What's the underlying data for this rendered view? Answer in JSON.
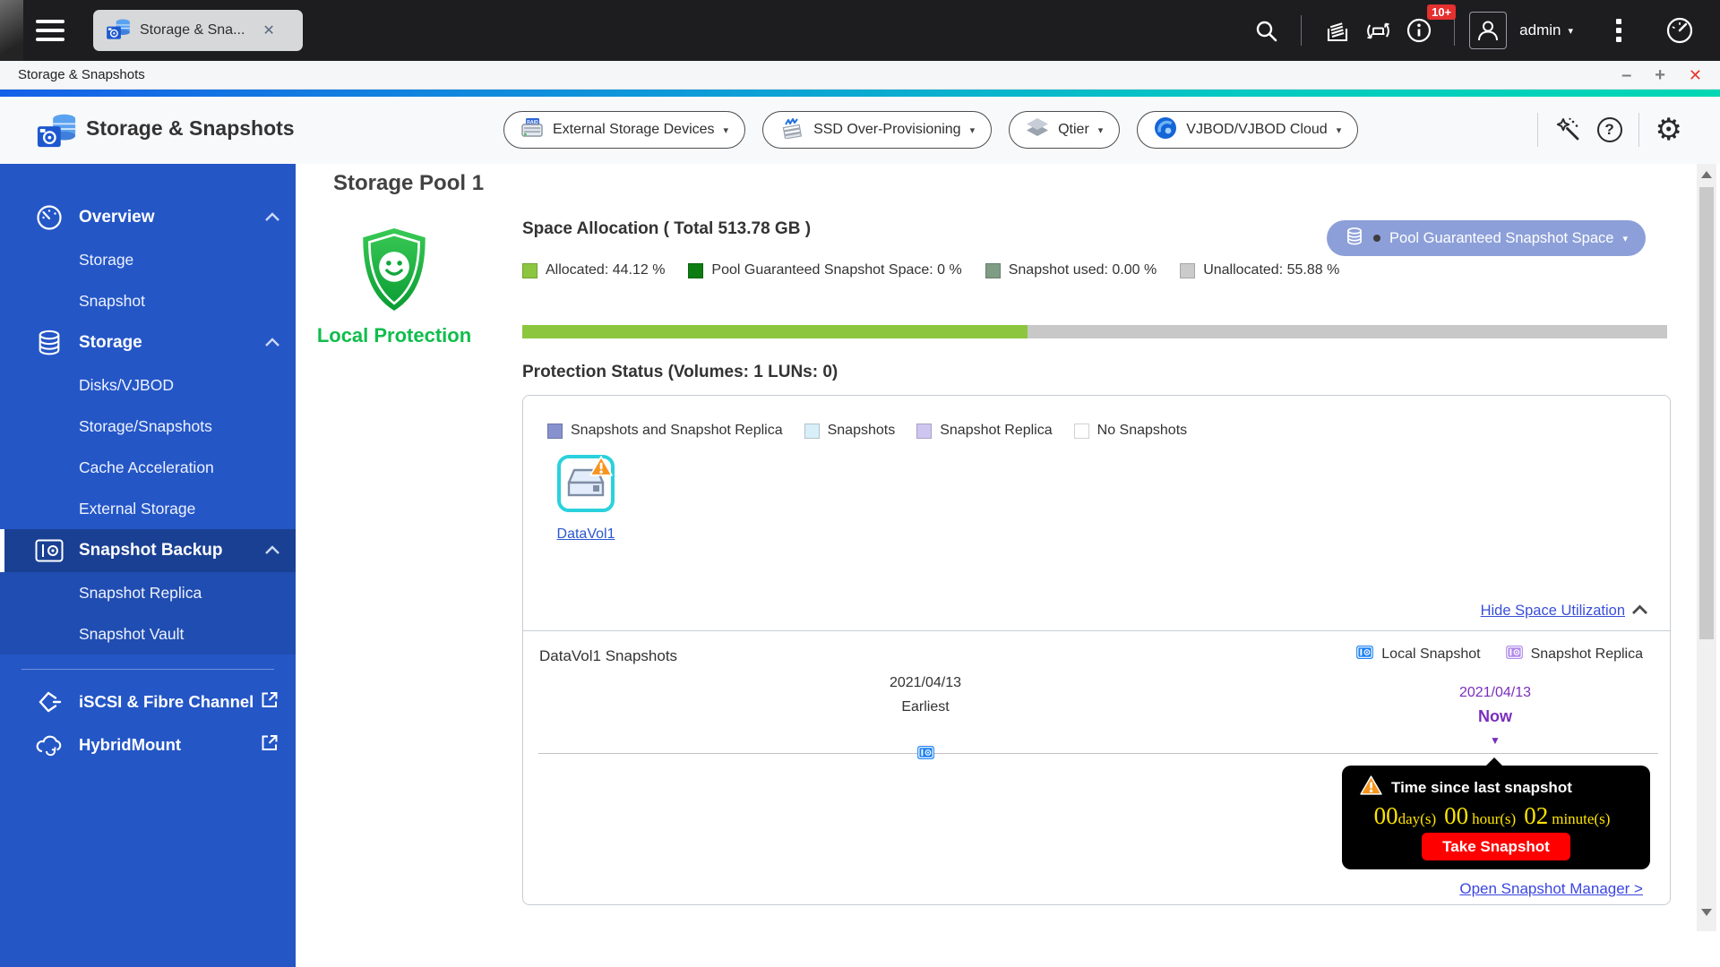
{
  "topbar": {
    "tab": {
      "label": "Storage & Sna...",
      "close_glyph": "✕"
    },
    "user": {
      "name": "admin",
      "caret": "▾"
    },
    "info_badge": "10+"
  },
  "window_bar": {
    "title": "Storage & Snapshots",
    "minimize": "–",
    "maximize": "+",
    "close": "✕"
  },
  "app_header": {
    "title": "Storage & Snapshots",
    "dropdowns": [
      {
        "label": "External Storage Devices",
        "caret": "▾"
      },
      {
        "label": "SSD Over-Provisioning",
        "caret": "▾"
      },
      {
        "label": "Qtier",
        "caret": "▾"
      },
      {
        "label": "VJBOD/VJBOD Cloud",
        "caret": "▾"
      }
    ],
    "help_glyph": "?",
    "gear_glyph": "⚙"
  },
  "sidebar": {
    "items": [
      {
        "label": "Overview"
      },
      {
        "label": "Storage"
      },
      {
        "label": "Snapshot"
      },
      {
        "label": "Storage"
      },
      {
        "label": "Disks/VJBOD"
      },
      {
        "label": "Storage/Snapshots"
      },
      {
        "label": "Cache Acceleration"
      },
      {
        "label": "External Storage"
      },
      {
        "label": "Snapshot Backup"
      },
      {
        "label": "Snapshot Replica"
      },
      {
        "label": "Snapshot Vault"
      },
      {
        "label": "iSCSI & Fibre Channel"
      },
      {
        "label": "HybridMount"
      }
    ]
  },
  "main": {
    "pool_title": "Storage Pool 1",
    "protection_label": "Local Protection",
    "space": {
      "title": "Space Allocation ( Total 513.78 GB )",
      "legend": [
        {
          "label": "Allocated: 44.12 %",
          "color": "#8CC63E"
        },
        {
          "label": "Pool Guaranteed Snapshot Space: 0 %",
          "color": "#0D7C12"
        },
        {
          "label": "Snapshot used: 0.00 %",
          "color": "#7F9C85"
        },
        {
          "label": "Unallocated: 55.88 %",
          "color": "#CBCBCB"
        }
      ],
      "selector": {
        "label": "Pool Guaranteed Snapshot Space",
        "caret": "▾"
      },
      "bar": {
        "allocated_width": "44.12%",
        "allocated_color": "#8CC63E",
        "track_color": "#C8C8C8"
      }
    },
    "protection": {
      "title": "Protection Status (Volumes: 1 LUNs: 0)",
      "legend": [
        {
          "label": "Snapshots and Snapshot Replica",
          "color": "#8791CE"
        },
        {
          "label": "Snapshots",
          "color": "#D8EEF8"
        },
        {
          "label": "Snapshot Replica",
          "color": "#CFC5F1"
        },
        {
          "label": "No Snapshots",
          "color": "#FFFFFF"
        }
      ],
      "volume_name": "DataVol1",
      "hide_link": "Hide Space Utilization"
    },
    "timeline": {
      "title": "DataVol1 Snapshots",
      "legend": [
        {
          "label": "Local Snapshot",
          "color": "#1E82F2"
        },
        {
          "label": "Snapshot Replica",
          "color": "#B18AEC"
        }
      ],
      "earliest_date": "2021/04/13",
      "earliest_label": "Earliest",
      "now_date": "2021/04/13",
      "now_label": "Now",
      "now_color": "#7A2EBB",
      "marker_glyph": "▼",
      "tooltip": {
        "title": "Time since last snapshot",
        "value_color": "#FFE400",
        "segments": [
          {
            "value": "00",
            "unit": "day(s)"
          },
          {
            "value": "00",
            "unit": "hour(s)"
          },
          {
            "value": "02",
            "unit": "minute(s)"
          }
        ],
        "button_label": "Take Snapshot",
        "button_color": "#FF0000"
      },
      "manager_link": "Open Snapshot Manager >"
    }
  }
}
